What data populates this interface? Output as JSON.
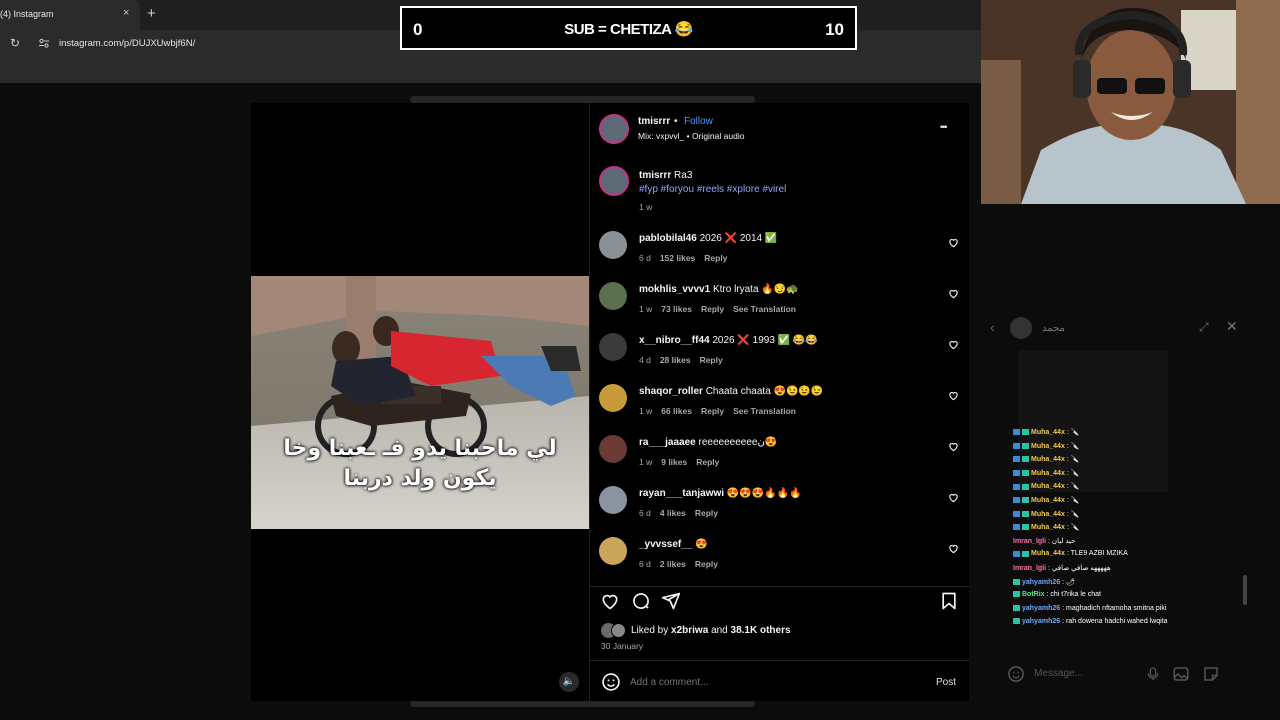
{
  "browser": {
    "tab_title": "(4) Instagram",
    "close_glyph": "×",
    "new_tab_glyph": "+",
    "reload_glyph": "↻",
    "url": "instagram.com/p/DUJXUwbjf6N/"
  },
  "banner": {
    "left": "0",
    "center": "SUB = CHETIZA 😂",
    "right": "10"
  },
  "post": {
    "author": "tmisrrr",
    "dot": "•",
    "follow_label": "Follow",
    "audio": "Mix: vxpvvl_ • Original audio",
    "more_glyph": "•••",
    "caption_user": "tmisrrr",
    "caption_text": "Ra3",
    "hashtags": "#fyp #foryou #reels #xplore #virel",
    "caption_age": "1 w",
    "photo_caption_line1": "لي ماحبنا يدو فـ ـعبنا وخا",
    "photo_caption_line2": "يكون ولد دربنا",
    "sound_glyph": "🔈",
    "likes_prefix": "Liked by",
    "likes_user": "x2briwa",
    "likes_and": "and",
    "likes_others": "38.1K others",
    "date": "30 January",
    "comment_placeholder": "Add a comment...",
    "post_button": "Post"
  },
  "comments": [
    {
      "user": "pablobilal46",
      "text": "2026 ❌ 2014 ✅",
      "age": "6 d",
      "likes": "152 likes",
      "reply": "Reply",
      "translate": ""
    },
    {
      "user": "mokhlis_vvvv1",
      "text": "Ktro lryata 🔥😏🐢",
      "age": "1 w",
      "likes": "73 likes",
      "reply": "Reply",
      "translate": "See Translation"
    },
    {
      "user": "x__nibro__ff44",
      "text": "2026 ❌ 1993 ✅ 😂😂",
      "age": "4 d",
      "likes": "28 likes",
      "reply": "Reply",
      "translate": ""
    },
    {
      "user": "shaqor_roller",
      "text": "Chaata chaata 😍😉😉😉",
      "age": "1 w",
      "likes": "66 likes",
      "reply": "Reply",
      "translate": "See Translation"
    },
    {
      "user": "ra___jaaaee",
      "text": "reeeeeeeeeeن😍",
      "age": "1 w",
      "likes": "9 likes",
      "reply": "Reply",
      "translate": ""
    },
    {
      "user": "rayan___tanjawwi",
      "text": "😍😍😍🔥🔥🔥",
      "age": "6 d",
      "likes": "4 likes",
      "reply": "Reply",
      "translate": ""
    },
    {
      "user": "_yvvssef__",
      "text": "😍",
      "age": "6 d",
      "likes": "2 likes",
      "reply": "Reply",
      "translate": ""
    }
  ],
  "chat": {
    "back_glyph": "‹",
    "title": "محمد",
    "expand_glyph": "⤢",
    "close_glyph": "✕",
    "messages": [
      {
        "user": "Muha_44x",
        "text": ": 🔪",
        "color": "#f2c94c"
      },
      {
        "user": "Muha_44x",
        "text": ": 🔪",
        "color": "#f2c94c"
      },
      {
        "user": "Muha_44x",
        "text": ": 🔪",
        "color": "#f2c94c"
      },
      {
        "user": "Muha_44x",
        "text": ": 🔪",
        "color": "#f2c94c"
      },
      {
        "user": "Muha_44x",
        "text": ": 🔪",
        "color": "#f2c94c"
      },
      {
        "user": "Muha_44x",
        "text": ": 🔪",
        "color": "#f2c94c"
      },
      {
        "user": "Muha_44x",
        "text": ": 🔪",
        "color": "#f2c94c"
      },
      {
        "user": "Muha_44x",
        "text": ": 🔪",
        "color": "#f2c94c"
      },
      {
        "user": "Imran_lgli",
        "text": ": حيد ليان",
        "color": "#ff6fae"
      },
      {
        "user": "Muha_44x",
        "text": ": TLE9 AZBI MZIKA",
        "color": "#f2c94c"
      },
      {
        "user": "Imran_lgli",
        "text": ": هههههه صافي صافي",
        "color": "#ff6fae"
      },
      {
        "user": "yahyamh26",
        "text": ": 🌶",
        "color": "#6aa8ff"
      },
      {
        "user": "BotRix",
        "text": ": chi t7rika le chat",
        "color": "#57e389"
      },
      {
        "user": "yahyamh26",
        "text": ": maghadich nftamoha smitna piki",
        "color": "#6aa8ff"
      },
      {
        "user": "yahyamh26",
        "text": ": rah dowena hadchi wahed lwqita",
        "color": "#6aa8ff"
      }
    ],
    "input_placeholder": "Message..."
  },
  "colors": {
    "follow": "#4a9dff",
    "story_ring": "#c13584",
    "bg": "#000000"
  }
}
